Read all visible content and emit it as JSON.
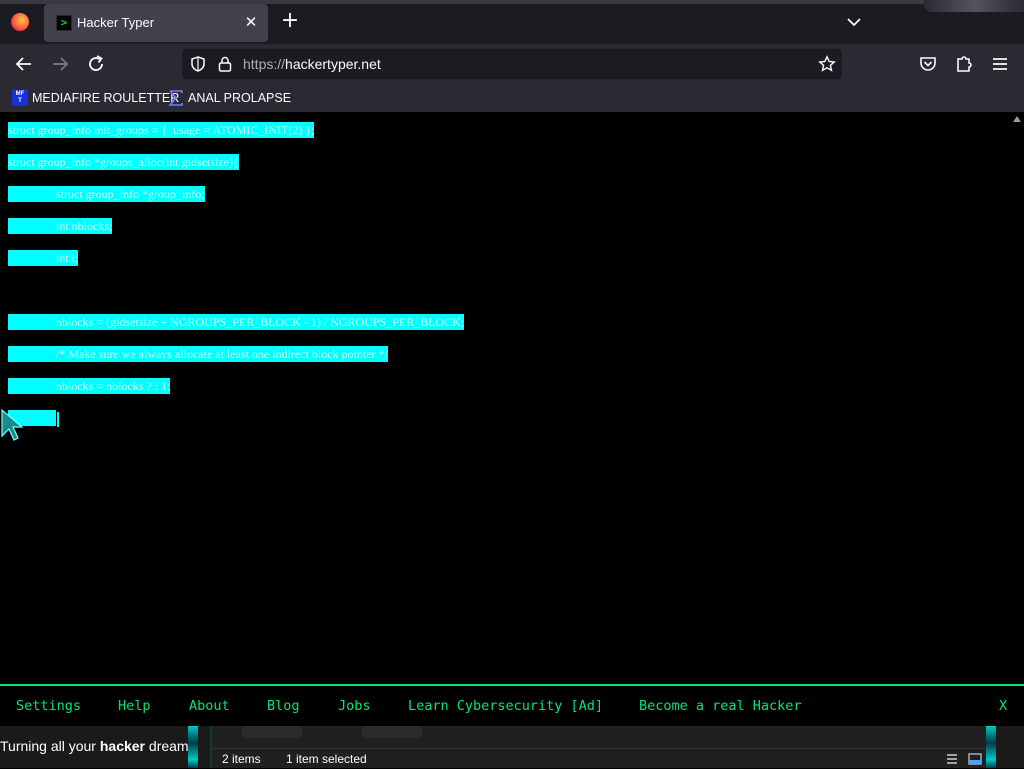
{
  "browser": {
    "tab": {
      "title": "Hacker Typer",
      "favicon": ">"
    },
    "url": {
      "protocol": "https://",
      "host": "hackertyper.net"
    },
    "bookmarks": [
      {
        "label": "MEDIAFIRE ROULETTER",
        "icon": "MF\nT"
      },
      {
        "label": "ANAL PROLAPSE",
        "icon": "sigma-icon"
      }
    ]
  },
  "code_lines": [
    "struct group_info init_groups = { .usage = ATOMIC_INIT(2) };",
    "struct group_info *groups_alloc(int gidsetsize){",
    "                struct group_info *group_info;",
    "                int nblocks;",
    "                int i;",
    "",
    "                nblocks = (gidsetsize + NGROUPS_PER_BLOCK - 1) / NGROUPS_PER_BLOCK;",
    "                /* Make sure we always allocate at least one indirect block pointer */",
    "                nblocks = nblocks ? : 1;",
    "                "
  ],
  "menu": {
    "settings": "Settings",
    "help": "Help",
    "about": "About",
    "blog": "Blog",
    "jobs": "Jobs",
    "learn": "Learn Cybersecurity [Ad]",
    "become": "Become a real Hacker",
    "close": "X"
  },
  "taskbar": {
    "ticker_pre": "Turning all your ",
    "ticker_bold": "hacker",
    "ticker_post": " dream",
    "status_items": "2 items",
    "status_selected": "1 item selected"
  },
  "colors": {
    "accent_green": "#00e676",
    "selection_cyan": "#00ffff"
  }
}
